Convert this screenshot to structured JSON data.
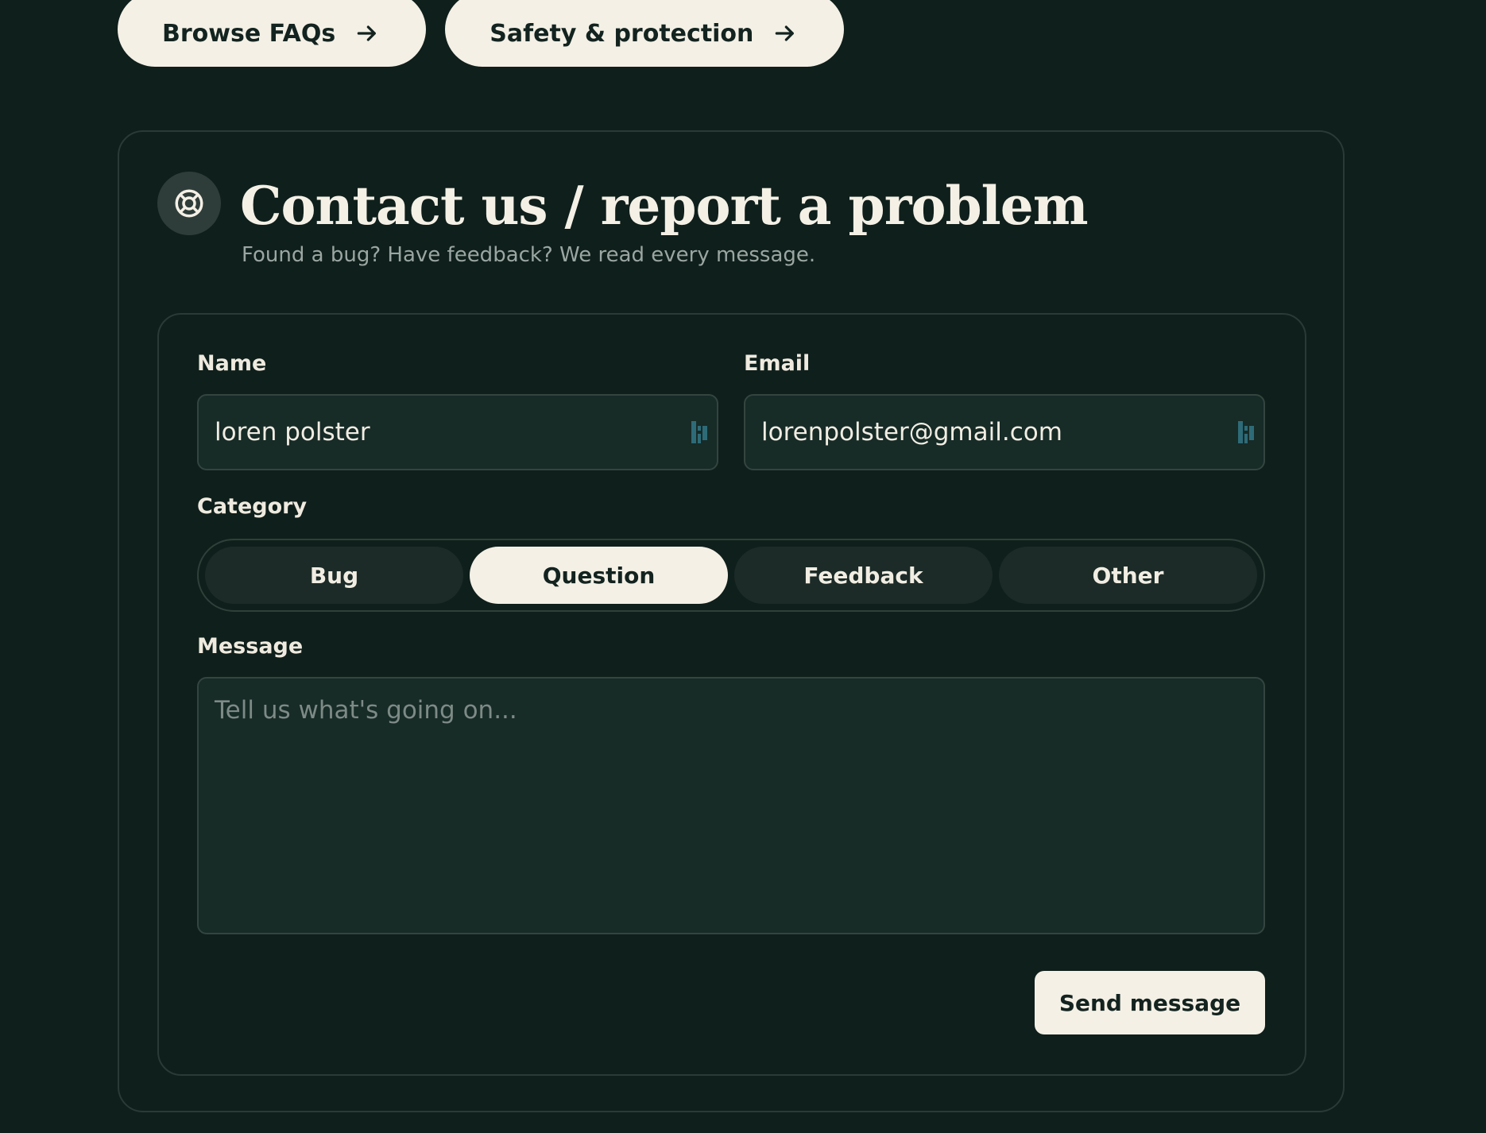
{
  "top_links": [
    {
      "label": "Browse FAQs",
      "icon": "arrow-right-icon"
    },
    {
      "label": "Safety & protection",
      "icon": "arrow-right-icon"
    }
  ],
  "contact": {
    "icon": "lifebuoy-icon",
    "title": "Contact us / report a problem",
    "subtitle": "Found a bug? Have feedback? We read every message."
  },
  "form": {
    "name_label": "Name",
    "name_value": "loren polster",
    "email_label": "Email",
    "email_value": "lorenpolster@gmail.com",
    "field_icon": "password-manager-icon",
    "category_label": "Category",
    "categories": [
      "Bug",
      "Question",
      "Feedback",
      "Other"
    ],
    "selected_category": "Question",
    "message_label": "Message",
    "message_placeholder": "Tell us what's going on...",
    "submit_label": "Send message"
  },
  "colors": {
    "background": "#0f1f1b",
    "cream": "#f4f0e6",
    "input_bg": "#172b27",
    "border": "#2a3a36"
  }
}
